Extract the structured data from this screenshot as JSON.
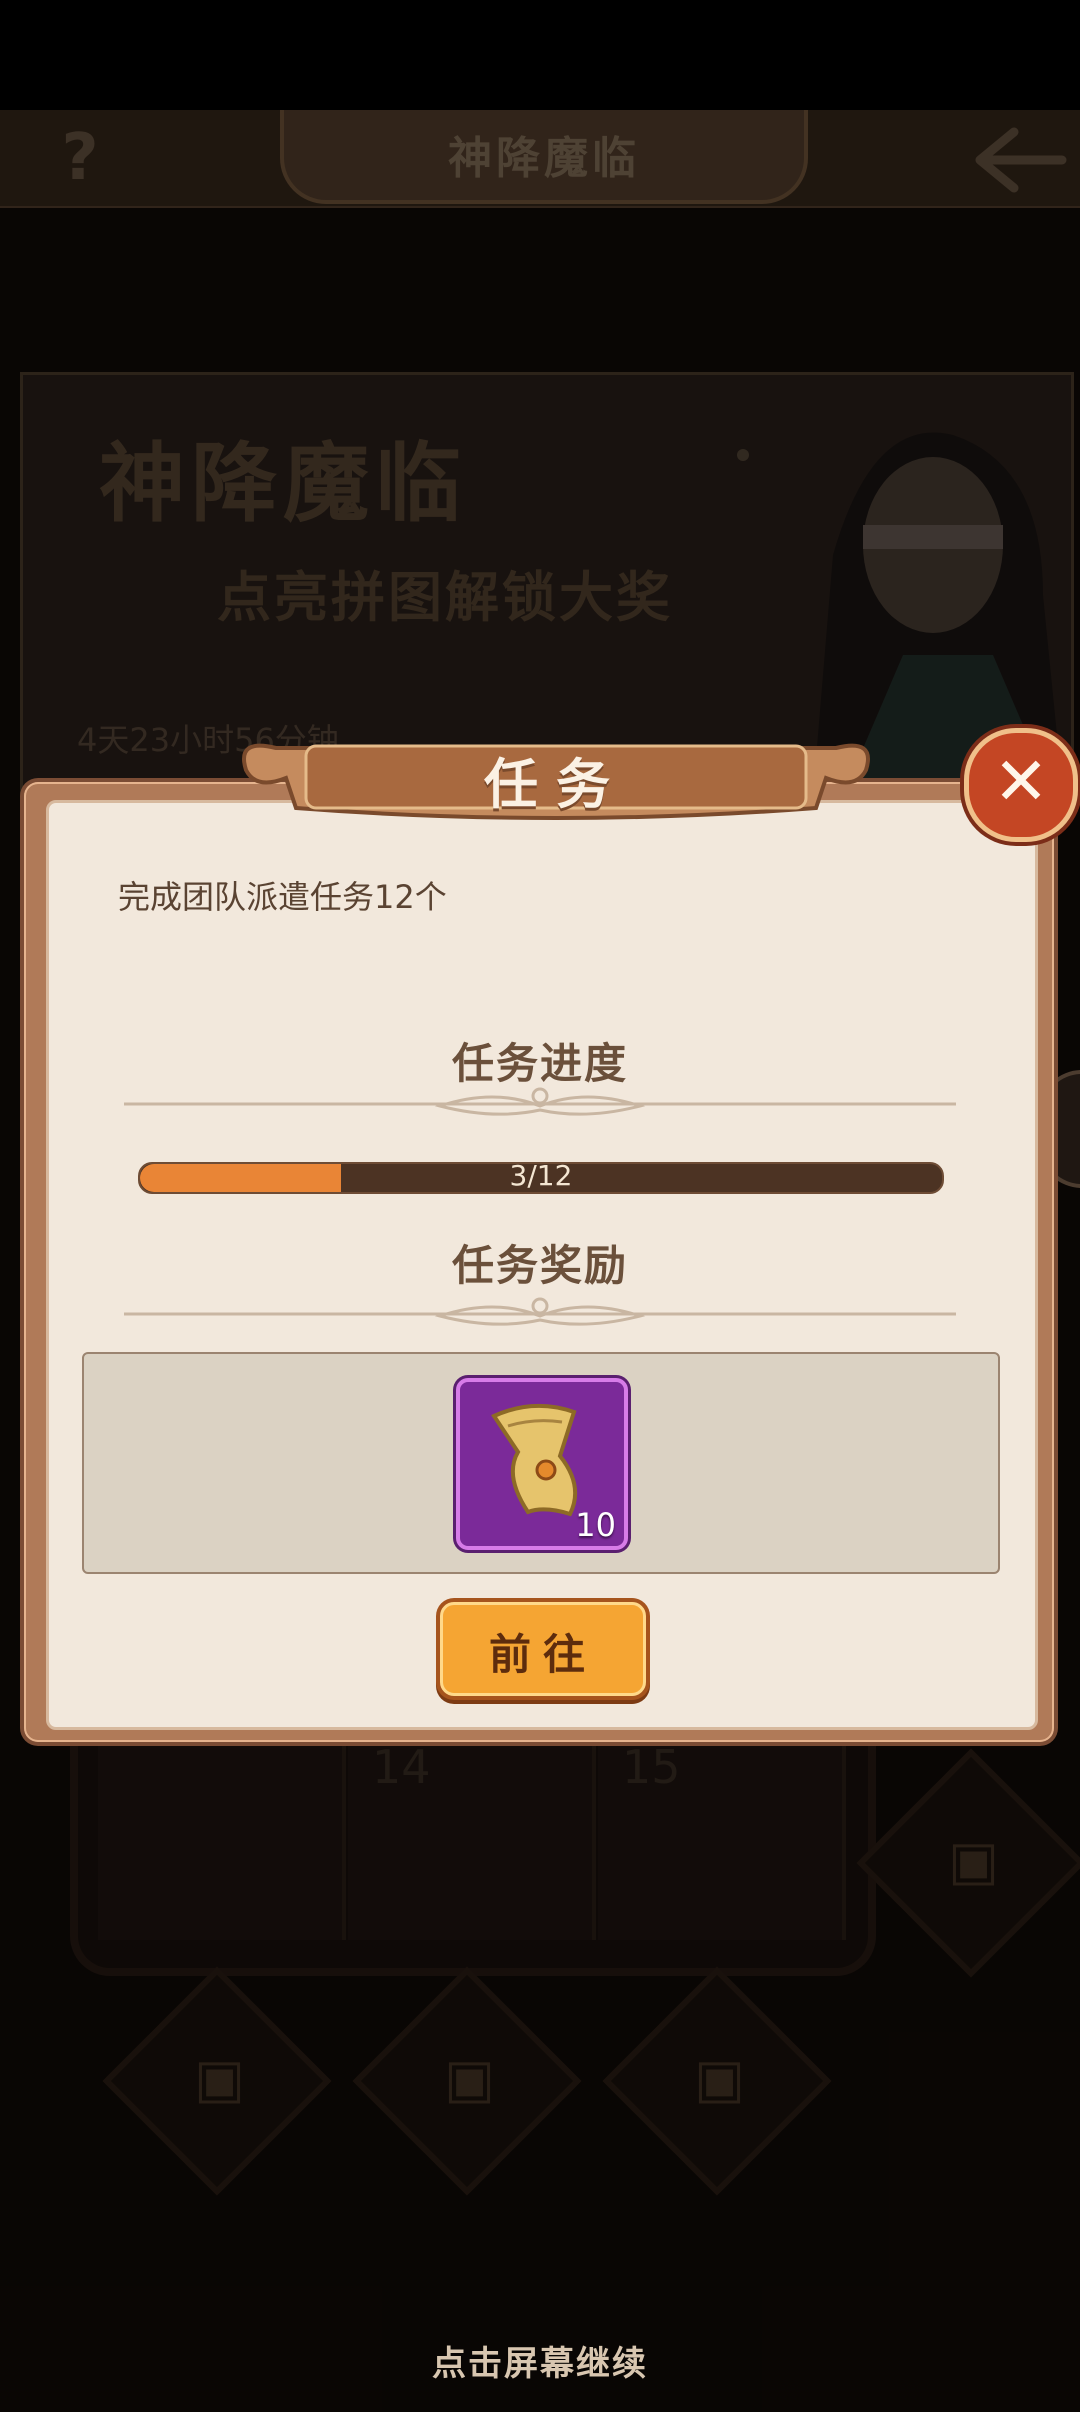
{
  "top_bar": {
    "title": "神降魔临",
    "help_glyph": "?"
  },
  "banner": {
    "title": "神降魔临",
    "subtitle": "点亮拼图解锁大奖",
    "timer": "4天23小时56分钟"
  },
  "puzzle": {
    "tiles": [
      {
        "number": ""
      },
      {
        "number": "14"
      },
      {
        "number": "15"
      }
    ]
  },
  "dialog": {
    "title": "任务",
    "close_glyph": "✕",
    "task_description": "完成团队派遣任务12个",
    "progress_heading": "任务进度",
    "progress": {
      "current": 3,
      "total": 12,
      "label": "3/12"
    },
    "reward_heading": "任务奖励",
    "reward": {
      "icon": "scroll-icon",
      "count": "10"
    },
    "go_button": "前往"
  },
  "footer": {
    "continue_hint": "点击屏幕继续"
  },
  "colors": {
    "progress_fill": "#e98536",
    "reward_rarity": "#7b2a99",
    "go_button": "#f5a533",
    "close_button": "#c44624"
  }
}
